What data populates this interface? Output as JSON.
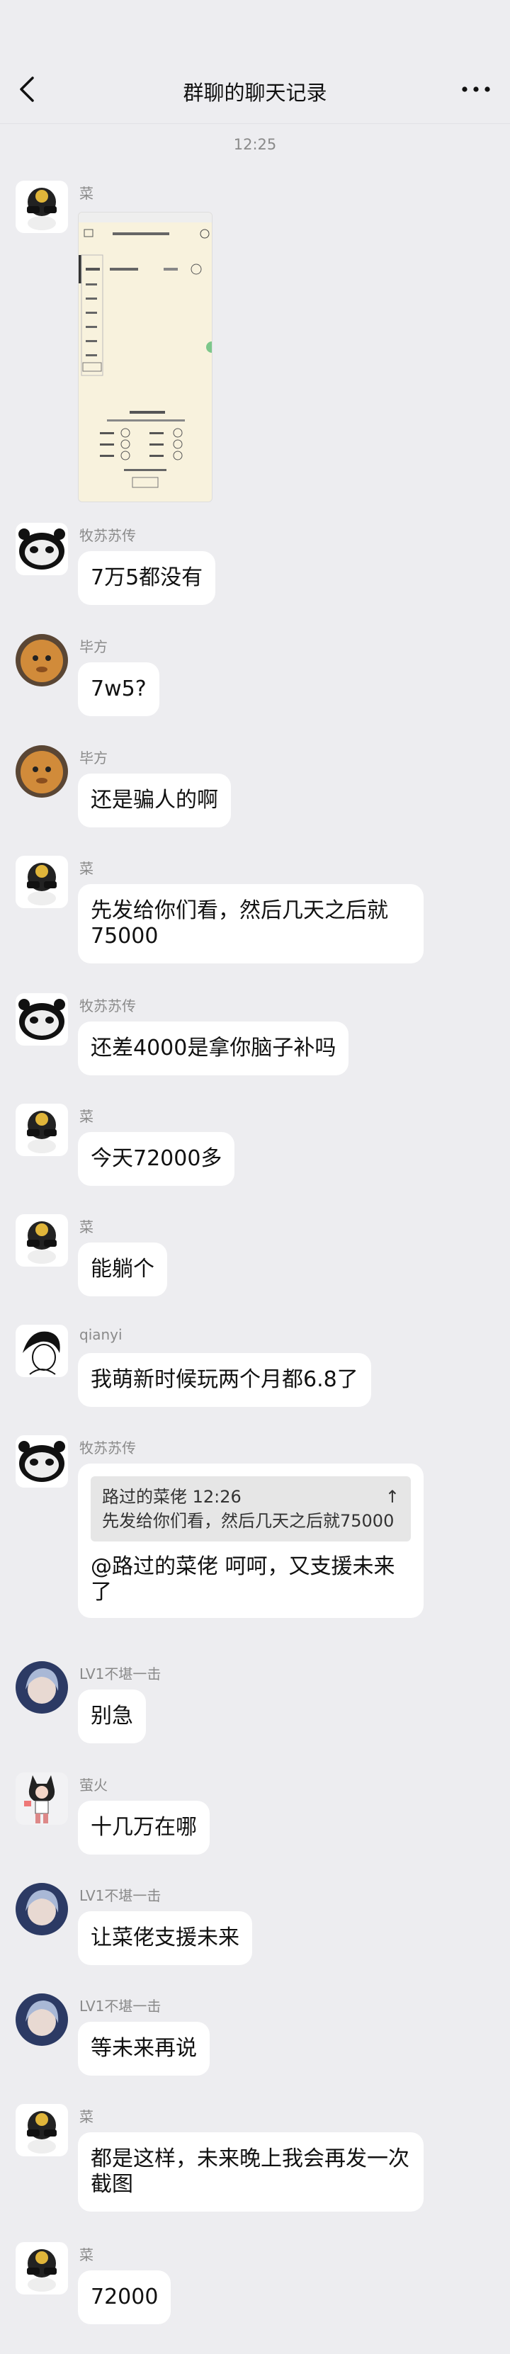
{
  "header": {
    "title": "群聊的聊天记录",
    "back_icon": "chevron-left-icon",
    "more_icon": "more-horizontal-icon"
  },
  "timestamp": "12:25",
  "messages": [
    {
      "sender": "菜",
      "type": "image"
    },
    {
      "sender": "牧苏苏传",
      "text": "7万5都没有"
    },
    {
      "sender": "毕方",
      "text": "7w5?"
    },
    {
      "sender": "毕方",
      "text": "还是骗人的啊"
    },
    {
      "sender": "菜",
      "text": "先发给你们看，然后几天之后就75000"
    },
    {
      "sender": "牧苏苏传",
      "text": "还差4000是拿你脑子补吗"
    },
    {
      "sender": "菜",
      "text": "今天72000多"
    },
    {
      "sender": "菜",
      "text": "能躺个"
    },
    {
      "sender": "qianyi",
      "text": "我萌新时候玩两个月都6.8了"
    },
    {
      "sender": "牧苏苏传",
      "quote_author": "路过的菜佬 12:26",
      "quote_text": "先发给你们看，然后几天之后就75000",
      "text": "@路过的菜佬 呵呵，又支援未来了"
    },
    {
      "sender": "LV1不堪一击",
      "text": "别急"
    },
    {
      "sender": "萤火",
      "text": "十几万在哪"
    },
    {
      "sender": "LV1不堪一击",
      "text": "让菜佬支援未来"
    },
    {
      "sender": "LV1不堪一击",
      "text": "等未来再说"
    },
    {
      "sender": "菜",
      "text": "都是这样，未来晚上我会再发一次截图"
    },
    {
      "sender": "菜",
      "text": "72000"
    }
  ]
}
